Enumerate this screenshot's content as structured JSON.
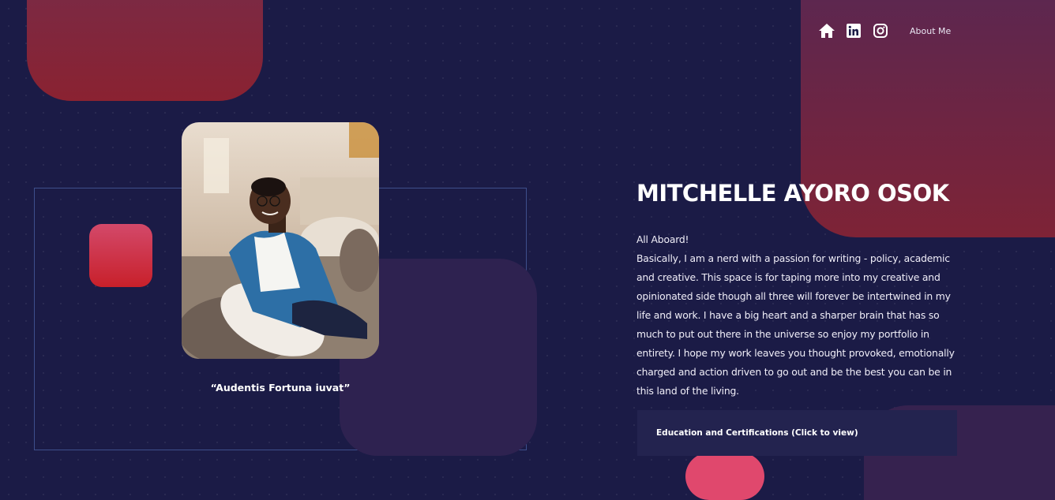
{
  "nav": {
    "icons": [
      "home-icon",
      "linkedin-icon",
      "instagram-icon"
    ],
    "about_label": "About Me"
  },
  "profile": {
    "name": "MITCHELLE AYORO OSOK",
    "quote": "“Audentis Fortuna iuvat”",
    "photo_alt": "Portrait photo"
  },
  "bio": {
    "greeting": "All Aboard!",
    "text": "Basically, I am a nerd with a passion for writing - policy, academic and creative. This space is for taping more into my creative and opinionated side though all three will forever be intertwined in my life and work. I have a big heart and a sharper brain that has so much to put out there in the universe so enjoy my portfolio in entirety. I hope my work leaves you thought provoked, emotionally charged and action driven to go out and be the best you can be in this land of the living."
  },
  "education": {
    "button_label": "Education and Certifications (Click to view)"
  },
  "colors": {
    "background": "#1b1b46",
    "accent_red": "#c8202a",
    "accent_pink": "#e0486d",
    "frame_blue": "#3e4f8c"
  }
}
